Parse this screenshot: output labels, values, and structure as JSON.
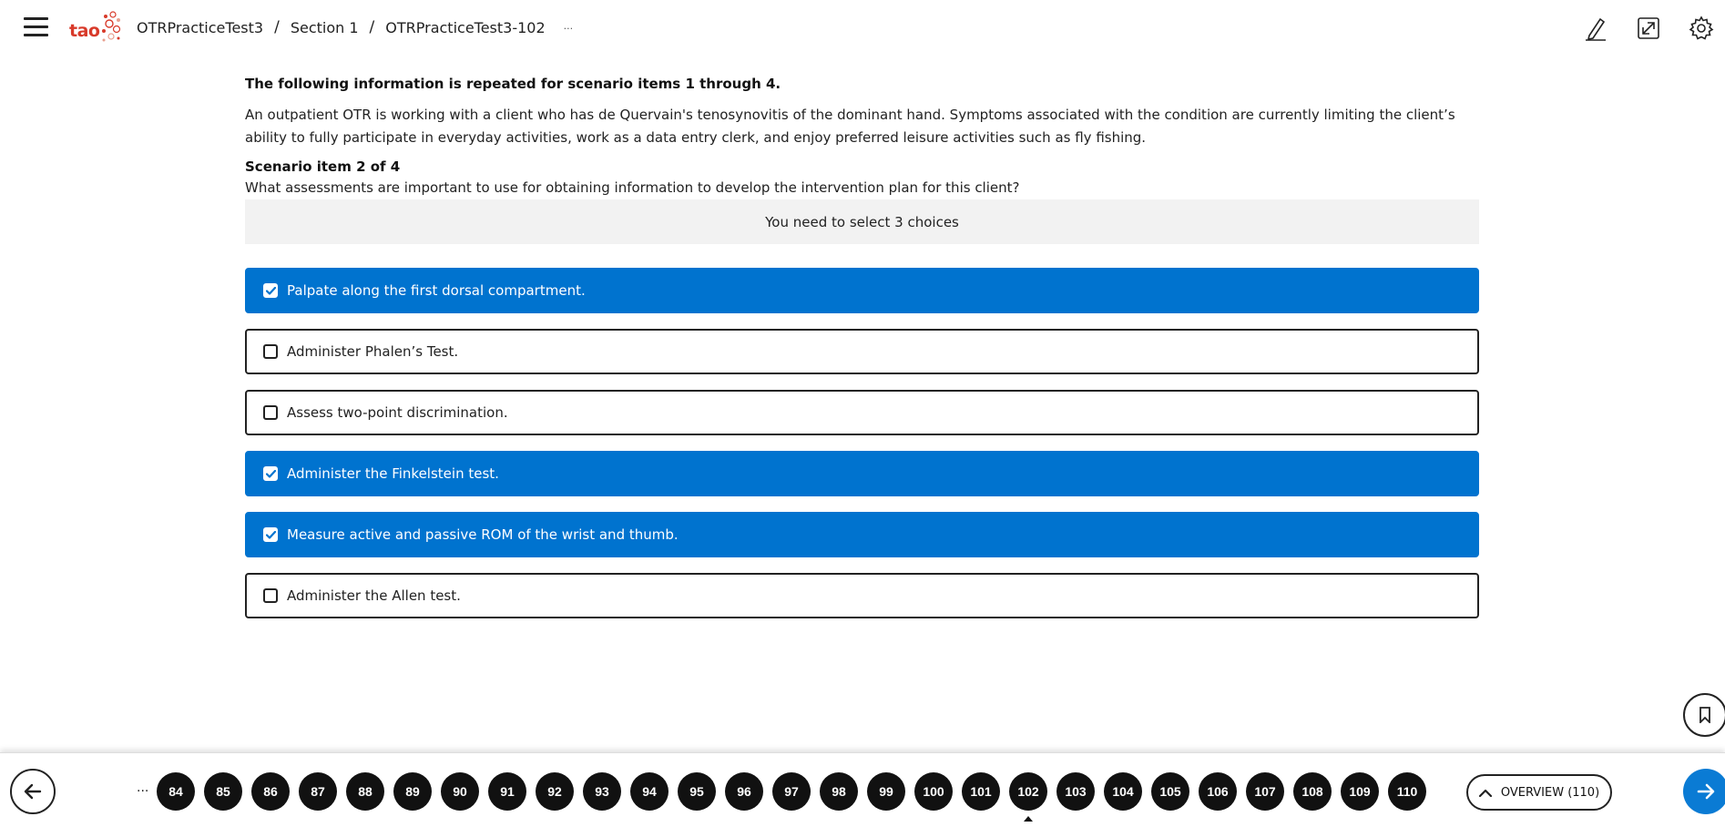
{
  "header": {
    "logo_text": "tao",
    "breadcrumb": [
      "OTRPracticeTest3",
      "Section 1",
      "OTRPracticeTest3-102"
    ],
    "more": "..."
  },
  "content": {
    "intro": "The following information is repeated for scenario items 1 through 4.",
    "scenario": "An outpatient OTR is working with a client who has de Quervain's tenosynovitis of the dominant hand. Symptoms associated with the condition are currently limiting the client’s ability to fully participate in everyday activities, work as a data entry clerk, and enjoy preferred leisure activities such as fly fishing.",
    "item_title": "Scenario item 2 of 4",
    "question": "What assessments are important to use for obtaining information to develop the intervention plan for this client?",
    "hint": "You need to select 3 choices",
    "choices": [
      {
        "label": "Palpate along the first dorsal compartment.",
        "selected": true
      },
      {
        "label": "Administer Phalen’s Test.",
        "selected": false
      },
      {
        "label": "Assess two-point discrimination.",
        "selected": false
      },
      {
        "label": "Administer the Finkelstein test.",
        "selected": true
      },
      {
        "label": "Measure active and passive ROM of the wrist and thumb.",
        "selected": true
      },
      {
        "label": "Administer the Allen test.",
        "selected": false
      }
    ]
  },
  "footer": {
    "ellipsis": "...",
    "pages": [
      "84",
      "85",
      "86",
      "87",
      "88",
      "89",
      "90",
      "91",
      "92",
      "93",
      "94",
      "95",
      "96",
      "97",
      "98",
      "99",
      "100",
      "101",
      "102",
      "103",
      "104",
      "105",
      "106",
      "107",
      "108",
      "109",
      "110"
    ],
    "current_page": "102",
    "overview_label": "OVERVIEW (110)"
  },
  "colors": {
    "accent": "#0073cf",
    "logo": "#d83a2a"
  },
  "icons": [
    "menu-icon",
    "pencil-icon",
    "fullscreen-icon",
    "gear-icon",
    "bookmark-icon",
    "arrow-left-icon",
    "arrow-right-icon",
    "chevron-up-icon",
    "checkbox-icon"
  ]
}
